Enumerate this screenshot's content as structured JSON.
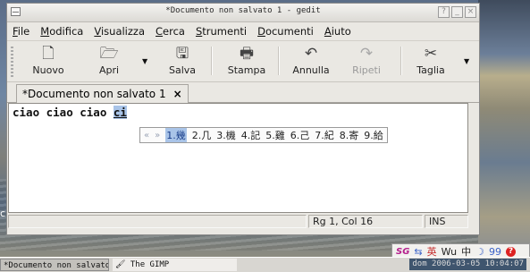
{
  "window": {
    "title": "*Documento non salvato 1 - gedit",
    "buttons": [
      "?",
      "_",
      "×"
    ]
  },
  "menu": [
    {
      "label": "File",
      "mnemonic": "F",
      "rest": "ile"
    },
    {
      "label": "Modifica",
      "mnemonic": "M",
      "rest": "odifica"
    },
    {
      "label": "Visualizza",
      "mnemonic": "V",
      "rest": "isualizza"
    },
    {
      "label": "Cerca",
      "mnemonic": "C",
      "rest": "erca"
    },
    {
      "label": "Strumenti",
      "mnemonic": "S",
      "rest": "trumenti"
    },
    {
      "label": "Documenti",
      "mnemonic": "D",
      "rest": "ocumenti"
    },
    {
      "label": "Aiuto",
      "mnemonic": "A",
      "rest": "iuto"
    }
  ],
  "toolbar": {
    "new": "Nuovo",
    "open": "Apri",
    "save": "Salva",
    "print": "Stampa",
    "undo": "Annulla",
    "redo": "Ripeti",
    "cut": "Taglia"
  },
  "tab": {
    "label": "*Documento non salvato 1",
    "close": "×"
  },
  "editor": {
    "text": "ciao ciao ciao ",
    "selection": "ci"
  },
  "ime_popup": {
    "prev": "«",
    "next": "»",
    "candidates": [
      "1.幾",
      "2.几",
      "3.機",
      "4.記",
      "5.雞",
      "6.己",
      "7.紀",
      "8.寄",
      "9.給"
    ]
  },
  "statusbar": {
    "position": "Rg 1, Col 16",
    "mode": "INS"
  },
  "desktop_text": "ch",
  "ime_bar": {
    "logo": "SG",
    "mode": "Wu",
    "lang": "中",
    "char1": "英",
    "moon": "☽",
    "num": "99",
    "help": "?"
  },
  "taskbar": {
    "task1": "*Documento non salvato...",
    "task2": "The GIMP",
    "clock": "dom 2006-03-05 10:04:07"
  }
}
